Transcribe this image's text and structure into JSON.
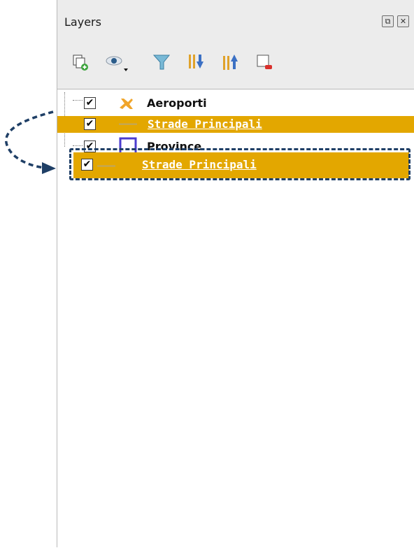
{
  "panel": {
    "title": "Layers",
    "window_buttons": [
      {
        "name": "float-button",
        "glyph": "⧉"
      },
      {
        "name": "close-button",
        "glyph": "✕"
      }
    ]
  },
  "toolbar": {
    "buttons": [
      {
        "name": "add-group-button",
        "icon": "add-group-icon"
      },
      {
        "name": "manage-visibility-button",
        "icon": "eye-icon"
      },
      {
        "name": "filter-legend-button",
        "icon": "filter-icon"
      },
      {
        "name": "expand-all-button",
        "icon": "expand-all-icon"
      },
      {
        "name": "collapse-all-button",
        "icon": "collapse-all-icon"
      },
      {
        "name": "remove-layer-button",
        "icon": "remove-layer-icon"
      }
    ]
  },
  "layers": [
    {
      "label": "Aeroporti",
      "checked": true,
      "icon": "airplane-icon",
      "selected": false
    },
    {
      "label": "Strade Principali",
      "checked": true,
      "icon": "line-icon",
      "selected": true
    },
    {
      "label": "Province",
      "checked": true,
      "icon": "polygon-icon",
      "selected": false
    }
  ],
  "drag_preview": {
    "label": "Strade Principali",
    "checked": true,
    "icon": "line-icon"
  },
  "colors": {
    "selection": "#e3a700",
    "arrow": "#1f3f66",
    "polygon_stroke": "#4b3ccf"
  }
}
